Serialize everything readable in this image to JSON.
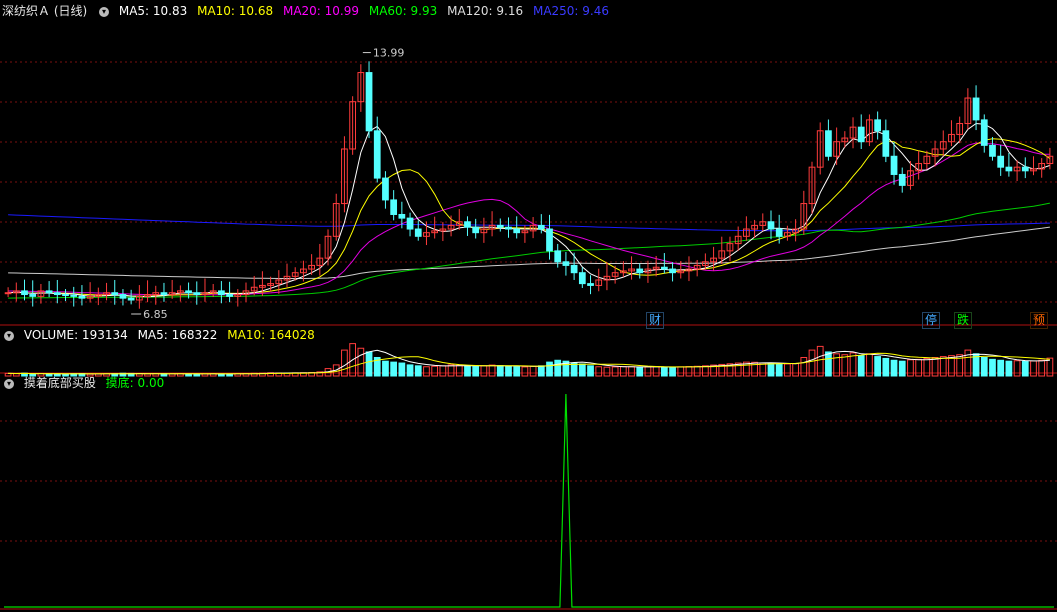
{
  "title": "深纺织Ａ (日线)",
  "ma_legend": [
    {
      "label": "MA5: 10.83",
      "color": "#ffffff"
    },
    {
      "label": "MA10: 10.68",
      "color": "#ffff00"
    },
    {
      "label": "MA20: 10.99",
      "color": "#ff00ff"
    },
    {
      "label": "MA60: 9.93",
      "color": "#00ff00"
    },
    {
      "label": "MA120: 9.16",
      "color": "#e0e0e0"
    },
    {
      "label": "MA250: 9.46",
      "color": "#0000ff"
    }
  ],
  "volume_legend": [
    {
      "label": "VOLUME: 193134",
      "color": "#ffffff"
    },
    {
      "label": "MA5: 168322",
      "color": "#ffffff"
    },
    {
      "label": "MA10: 164028",
      "color": "#ffff00"
    }
  ],
  "indicator": {
    "name": "摸着底部买股",
    "value_label": "摸底: 0.00",
    "value_color": "#00ff00"
  },
  "annotations": {
    "high": "13.99",
    "low": "6.85"
  },
  "event_tags": [
    {
      "text": "财",
      "color": "#44aaff"
    },
    {
      "text": "停",
      "color": "#44aaff"
    },
    {
      "text": "跌",
      "color": "#00ff00"
    },
    {
      "text": "预",
      "color": "#ff6600"
    }
  ],
  "chart_data": {
    "type": "candlestick",
    "price_range": [
      6.3,
      14.6
    ],
    "up_color": "#ff3c3c",
    "down_color": "#54ffff",
    "close": [
      7.05,
      7.1,
      7.0,
      6.95,
      7.1,
      7.05,
      7.0,
      6.98,
      6.95,
      6.9,
      6.95,
      7.0,
      7.05,
      7.0,
      6.9,
      6.85,
      6.95,
      7.0,
      7.05,
      7.0,
      7.05,
      7.1,
      7.05,
      7.0,
      7.05,
      7.1,
      7.0,
      6.95,
      7.0,
      7.1,
      7.2,
      7.25,
      7.3,
      7.4,
      7.5,
      7.6,
      7.7,
      7.8,
      8.0,
      8.6,
      9.5,
      11.0,
      12.3,
      13.1,
      11.5,
      10.2,
      9.6,
      9.2,
      9.1,
      8.8,
      8.6,
      8.7,
      8.75,
      8.8,
      8.9,
      9.0,
      8.85,
      8.7,
      8.8,
      8.9,
      8.85,
      8.8,
      8.7,
      8.75,
      8.9,
      8.8,
      8.2,
      7.9,
      7.8,
      7.6,
      7.3,
      7.25,
      7.4,
      7.5,
      7.6,
      7.65,
      7.7,
      7.6,
      7.7,
      7.75,
      7.7,
      7.6,
      7.65,
      7.7,
      7.8,
      7.9,
      8.0,
      8.2,
      8.4,
      8.6,
      8.8,
      8.9,
      9.0,
      8.8,
      8.6,
      8.7,
      8.8,
      9.5,
      10.5,
      11.5,
      10.8,
      11.2,
      11.3,
      11.6,
      11.2,
      11.8,
      11.5,
      10.8,
      10.3,
      10.0,
      10.4,
      10.6,
      10.8,
      11.0,
      11.2,
      11.4,
      11.7,
      12.4,
      11.8,
      11.1,
      10.8,
      10.5,
      10.4,
      10.5,
      10.4,
      10.45,
      10.6,
      10.8
    ],
    "moving_averages": {
      "MA5": 10.83,
      "MA10": 10.68,
      "MA20": 10.99,
      "MA60": 9.93,
      "MA120": 9.16,
      "MA250": 9.46
    },
    "volume": [
      28000,
      25000,
      30000,
      22000,
      26000,
      24000,
      23000,
      21000,
      25000,
      27000,
      20000,
      22000,
      24000,
      26000,
      30000,
      28000,
      25000,
      22000,
      24000,
      26000,
      23000,
      25000,
      22000,
      21000,
      24000,
      26000,
      23000,
      22000,
      25000,
      27000,
      30000,
      32000,
      35000,
      33000,
      31000,
      34000,
      36000,
      38000,
      45000,
      80000,
      120000,
      280000,
      350000,
      300000,
      260000,
      200000,
      160000,
      150000,
      140000,
      120000,
      110000,
      100000,
      105000,
      110000,
      120000,
      115000,
      108000,
      102000,
      110000,
      118000,
      112000,
      105000,
      100000,
      98000,
      104000,
      110000,
      150000,
      170000,
      160000,
      140000,
      130000,
      110000,
      100000,
      95000,
      98000,
      102000,
      100000,
      96000,
      98000,
      100000,
      97000,
      95000,
      99000,
      102000,
      105000,
      110000,
      118000,
      125000,
      132000,
      140000,
      150000,
      148000,
      140000,
      135000,
      128000,
      130000,
      134000,
      200000,
      280000,
      320000,
      260000,
      240000,
      230000,
      250000,
      220000,
      240000,
      210000,
      190000,
      170000,
      160000,
      175000,
      180000,
      190000,
      200000,
      210000,
      220000,
      230000,
      280000,
      240000,
      200000,
      180000,
      170000,
      160000,
      165000,
      158000,
      162000,
      170000,
      193134
    ],
    "indicator_range": [
      0,
      100
    ],
    "indicator_values": "zero everywhere except a single spike near the middle of the visible period"
  }
}
